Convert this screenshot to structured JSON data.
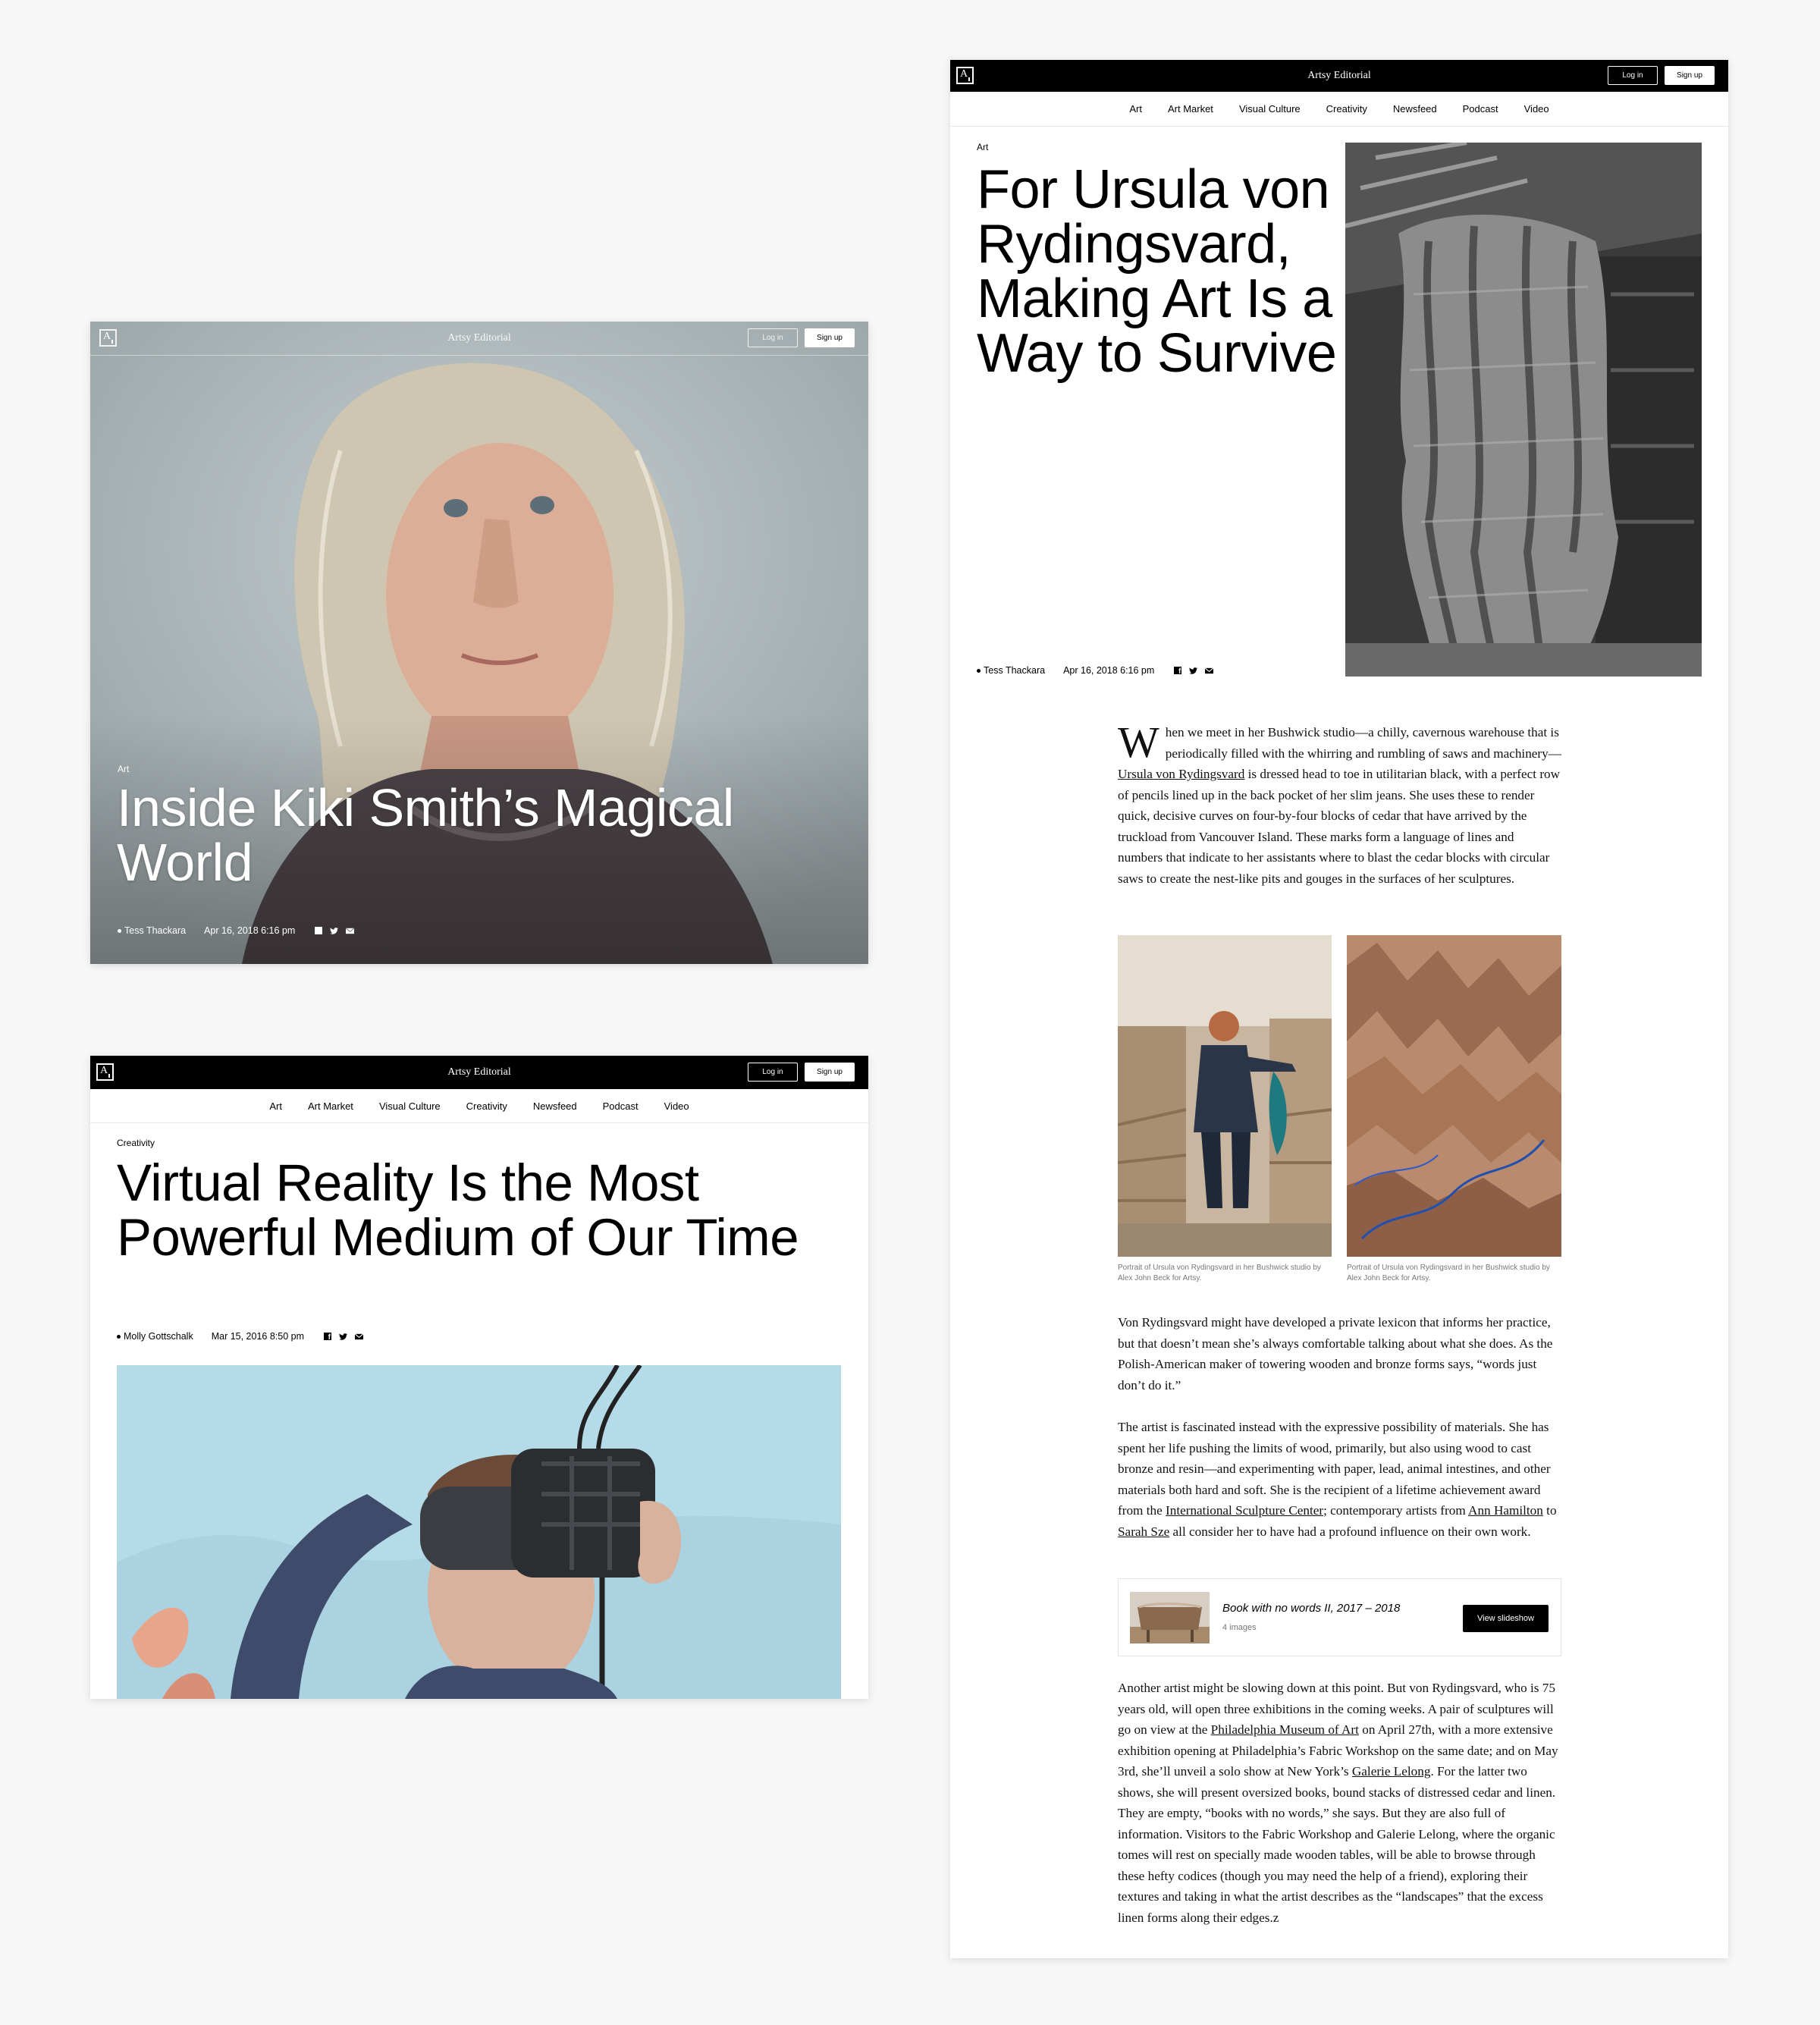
{
  "cards": [
    {
      "site_title": "Artsy Editorial",
      "login": "Log in",
      "signup": "Sign up",
      "category": "Art",
      "title_line1": "Inside Kiki Smith’s Magical",
      "title_line2": "World",
      "author": "Tess Thackara",
      "date": "Apr 16, 2018 6:16 pm"
    },
    {
      "site_title": "Artsy Editorial",
      "login": "Log in",
      "signup": "Sign up",
      "nav": [
        "Art",
        "Art Market",
        "Visual Culture",
        "Creativity",
        "Newsfeed",
        "Podcast",
        "Video"
      ],
      "category": "Creativity",
      "title_line1": "Virtual Reality Is the Most",
      "title_line2": "Powerful Medium of Our Time",
      "author": "Molly Gottschalk",
      "date": "Mar 15, 2016 8:50 pm"
    },
    {
      "site_title": "Artsy Editorial",
      "login": "Log in",
      "signup": "Sign up",
      "nav": [
        "Art",
        "Art Market",
        "Visual Culture",
        "Creativity",
        "Newsfeed",
        "Podcast",
        "Video"
      ],
      "category": "Art",
      "title_lines": [
        "For Ursula von",
        "Rydingsvard,",
        "Making Art Is a",
        "Way to Survive"
      ],
      "author": "Tess Thackara",
      "date": "Apr 16, 2018 6:16 pm",
      "p1": {
        "dropcap": "W",
        "t1": "hen we meet in her Bushwick studio—a chilly, cavernous warehouse that is periodically filled with the whirring and rumbling of saws and machinery—",
        "link1": "Ursula von Rydingsvard",
        "t2": " is dressed head to toe in utilitarian black, with a perfect row of pencils lined up in the back pocket of her slim jeans. She uses these to render quick, decisive curves on four-by-four blocks of cedar that have arrived by the truckload from Vancouver Island. These marks form a language of lines and numbers that indicate to her assistants where to blast the cedar blocks with circular saws to create the nest-like pits and gouges in the surfaces of her sculptures."
      },
      "caption1": "Portrait of Ursula von Rydingsvard in her Bushwick studio by Alex John Beck for Artsy.",
      "caption2": "Portrait of Ursula von Rydingsvard in her Bushwick studio by Alex John Beck for Artsy.",
      "p2": "Von Rydingsvard might have developed a private lexicon that informs her practice, but that doesn’t mean she’s always comfortable talking about what she does. As the Polish-American maker of towering wooden and bronze forms says, “words just don’t do it.”",
      "p3": {
        "t1": "The artist is fascinated instead with the expressive possibility of materials. She has spent her life pushing the limits of wood, primarily, but also using wood to cast bronze and resin—and experimenting with paper, lead, animal intestines, and other materials both hard and soft. She is the recipient of a lifetime achievement award from the ",
        "link1": "International Sculpture Center",
        "t2": "; contemporary artists from ",
        "link2": "Ann Hamilton",
        "t3": " to ",
        "link3": "Sarah Sze",
        "t4": " all consider her to have had a profound influence on their own work."
      },
      "slideshow": {
        "title": "Book with no words II, 2017 – 2018",
        "count": "4 images",
        "button": "View slideshow"
      },
      "p4": {
        "t1": "Another artist might be slowing down at this point. But von Rydingsvard, who is 75 years old, will open three exhibitions in the coming weeks. A pair of sculptures will go on view at the ",
        "link1": "Philadelphia Museum of Art",
        "t2": " on April 27th, with a more extensive exhibition opening at Philadelphia’s Fabric Workshop on the same date; and on May 3rd, she’ll unveil a solo show at New York’s ",
        "link2": "Galerie Lelong",
        "t3": ". For the latter two shows, she will present oversized books, bound stacks of distressed cedar and linen. They are empty, “books with no words,” she says. But they are also full of information. Visitors to the Fabric Workshop and Galerie Lelong, where the organic tomes will rest on specially made wooden tables, will be able to browse through these hefty codices (though you may need the help of a friend), exploring their textures and taking in what the artist describes as the “landscapes” that the excess linen forms along their edges.z"
      }
    }
  ]
}
